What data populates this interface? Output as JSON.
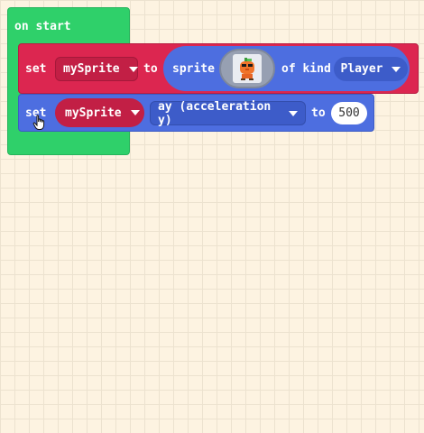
{
  "on_start": {
    "label": "on start"
  },
  "block1": {
    "set_label": "set",
    "variable": "mySprite",
    "to_label": "to",
    "sprite_label": "sprite",
    "sprite_image": "orange-character-sprite",
    "of_kind_label": "of kind",
    "kind": "Player"
  },
  "block2": {
    "set_label": "set",
    "variable": "mySprite",
    "property": "ay (acceleration y)",
    "to_label": "to",
    "value": "500"
  },
  "colors": {
    "hat_green": "#2fd06a",
    "sprites_red": "#dc2650",
    "sprites_blue": "#4d6ee0",
    "workspace_bg": "#fdf3e1"
  },
  "cursor": "hand-pointer-icon"
}
